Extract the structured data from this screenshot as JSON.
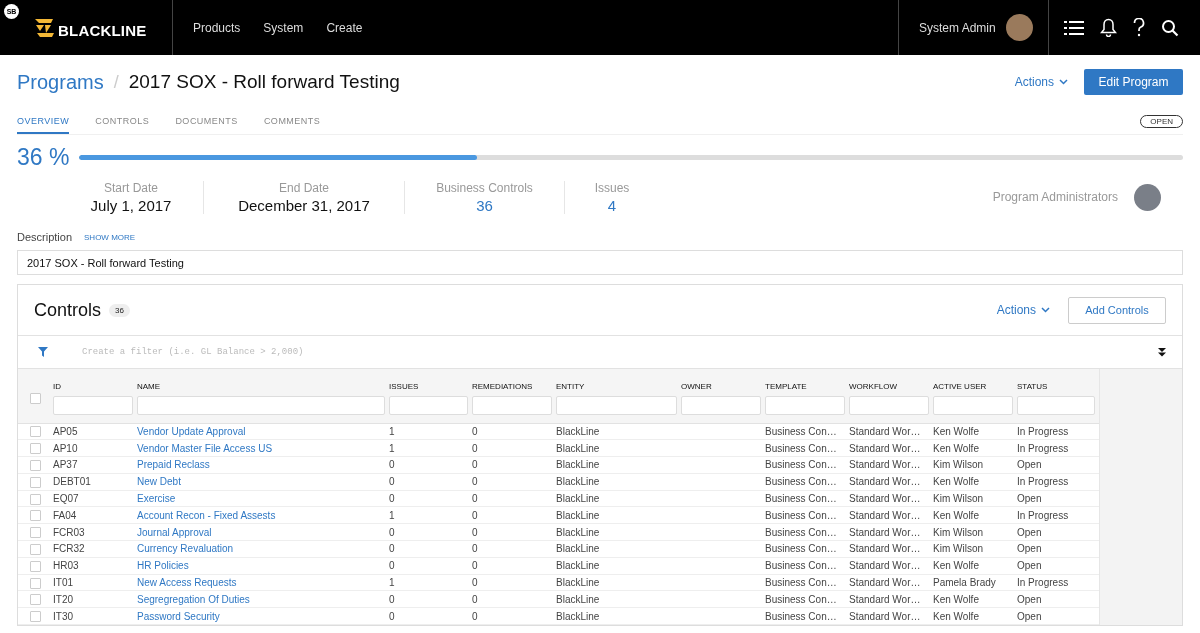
{
  "header": {
    "user_badge": "SB",
    "logo_text": "BLACKLINE",
    "nav": [
      "Products",
      "System",
      "Create"
    ],
    "user_name": "System Admin"
  },
  "breadcrumb": {
    "parent": "Programs",
    "separator": "/",
    "title": "2017 SOX - Roll forward Testing"
  },
  "actions_label": "Actions",
  "edit_button": "Edit Program",
  "tabs": [
    {
      "label": "OVERVIEW",
      "selected": true
    },
    {
      "label": "CONTROLS",
      "selected": false
    },
    {
      "label": "DOCUMENTS",
      "selected": false
    },
    {
      "label": "COMMENTS",
      "selected": false
    }
  ],
  "status_badge": "OPEN",
  "progress": {
    "reading": "36 %",
    "level": 0.36
  },
  "stats": [
    {
      "label": "Start Date",
      "value": "July 1, 2017",
      "kind": "plain"
    },
    {
      "label": "End Date",
      "value": "December 31, 2017",
      "kind": "plain"
    },
    {
      "label": "Business Controls",
      "value": "36",
      "kind": "link"
    },
    {
      "label": "Issues",
      "value": "4",
      "kind": "link"
    }
  ],
  "administrators_label": "Program Administrators",
  "description": {
    "label": "Description",
    "show_more": "SHOW MORE",
    "value": "2017 SOX - Roll forward Testing"
  },
  "controls": {
    "title": "Controls",
    "count": "36",
    "actions_label": "Actions",
    "add_button": "Add Controls",
    "filter_placeholder": "Create a filter (i.e. GL Balance > 2,000)",
    "select_all_checked": false,
    "columns": [
      "ID",
      "NAME",
      "ISSUES",
      "REMEDIATIONS",
      "ENTITY",
      "OWNER",
      "TEMPLATE",
      "WORKFLOW",
      "ACTIVE USER",
      "STATUS"
    ],
    "rows": [
      {
        "checked": false,
        "cells": [
          "AP05",
          "Vendor Update Approval",
          "1",
          "0",
          "BlackLine",
          "",
          "Business Con…",
          "Standard Wor…",
          "Ken Wolfe",
          "In Progress"
        ]
      },
      {
        "checked": false,
        "cells": [
          "AP10",
          "Vendor Master File Access US",
          "1",
          "0",
          "BlackLine",
          "",
          "Business Con…",
          "Standard Wor…",
          "Ken Wolfe",
          "In Progress"
        ]
      },
      {
        "checked": false,
        "cells": [
          "AP37",
          "Prepaid Reclass",
          "0",
          "0",
          "BlackLine",
          "",
          "Business Con…",
          "Standard Wor…",
          "Kim Wilson",
          "Open"
        ]
      },
      {
        "checked": false,
        "cells": [
          "DEBT01",
          "New Debt",
          "0",
          "0",
          "BlackLine",
          "",
          "Business Con…",
          "Standard Wor…",
          "Ken Wolfe",
          "In Progress"
        ]
      },
      {
        "checked": false,
        "cells": [
          "EQ07",
          "Exercise",
          "0",
          "0",
          "BlackLine",
          "",
          "Business Con…",
          "Standard Wor…",
          "Kim Wilson",
          "Open"
        ]
      },
      {
        "checked": false,
        "cells": [
          "FA04",
          "Account Recon - Fixed Assests",
          "1",
          "0",
          "BlackLine",
          "",
          "Business Con…",
          "Standard Wor…",
          "Ken Wolfe",
          "In Progress"
        ]
      },
      {
        "checked": false,
        "cells": [
          "FCR03",
          "Journal Approval",
          "0",
          "0",
          "BlackLine",
          "",
          "Business Con…",
          "Standard Wor…",
          "Kim Wilson",
          "Open"
        ]
      },
      {
        "checked": false,
        "cells": [
          "FCR32",
          "Currency Revaluation",
          "0",
          "0",
          "BlackLine",
          "",
          "Business Con…",
          "Standard Wor…",
          "Kim Wilson",
          "Open"
        ]
      },
      {
        "checked": false,
        "cells": [
          "HR03",
          "HR Policies",
          "0",
          "0",
          "BlackLine",
          "",
          "Business Con…",
          "Standard Wor…",
          "Ken Wolfe",
          "Open"
        ]
      },
      {
        "checked": false,
        "cells": [
          "IT01",
          "New Access Requests",
          "1",
          "0",
          "BlackLine",
          "",
          "Business Con…",
          "Standard Wor…",
          "Pamela Brady",
          "In Progress"
        ]
      },
      {
        "checked": false,
        "cells": [
          "IT20",
          "Segregregation Of Duties",
          "0",
          "0",
          "BlackLine",
          "",
          "Business Con…",
          "Standard Wor…",
          "Ken Wolfe",
          "Open"
        ]
      },
      {
        "checked": false,
        "cells": [
          "IT30",
          "Password Security",
          "0",
          "0",
          "BlackLine",
          "",
          "Business Con…",
          "Standard Wor…",
          "Ken Wolfe",
          "Open"
        ]
      }
    ]
  }
}
